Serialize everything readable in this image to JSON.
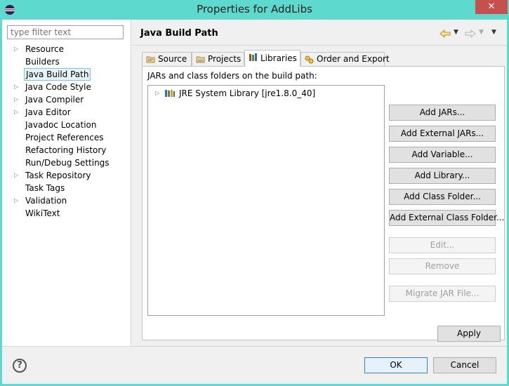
{
  "window": {
    "title": "Properties for AddLibs",
    "close_label": "✕"
  },
  "filter": {
    "placeholder": "type filter text",
    "value": ""
  },
  "nav": {
    "items": [
      {
        "label": "Resource",
        "expandable": true
      },
      {
        "label": "Builders",
        "expandable": false
      },
      {
        "label": "Java Build Path",
        "expandable": false,
        "selected": true
      },
      {
        "label": "Java Code Style",
        "expandable": true
      },
      {
        "label": "Java Compiler",
        "expandable": true
      },
      {
        "label": "Java Editor",
        "expandable": true
      },
      {
        "label": "Javadoc Location",
        "expandable": false
      },
      {
        "label": "Project References",
        "expandable": false
      },
      {
        "label": "Refactoring History",
        "expandable": false
      },
      {
        "label": "Run/Debug Settings",
        "expandable": false
      },
      {
        "label": "Task Repository",
        "expandable": true
      },
      {
        "label": "Task Tags",
        "expandable": false
      },
      {
        "label": "Validation",
        "expandable": true
      },
      {
        "label": "WikiText",
        "expandable": false
      }
    ]
  },
  "page": {
    "title": "Java Build Path"
  },
  "tabs": [
    {
      "label": "Source",
      "icon": "source-folder-icon"
    },
    {
      "label": "Projects",
      "icon": "projects-folder-icon"
    },
    {
      "label": "Libraries",
      "icon": "libraries-icon",
      "active": true
    },
    {
      "label": "Order and Export",
      "icon": "order-export-icon"
    }
  ],
  "libraries": {
    "caption": "JARs and class folders on the build path:",
    "entries": [
      {
        "label": "JRE System Library [jre1.8.0_40]",
        "icon": "jre-library-icon"
      }
    ],
    "buttons": {
      "add_jars": "Add JARs...",
      "add_external_jars": "Add External JARs...",
      "add_variable": "Add Variable...",
      "add_library": "Add Library...",
      "add_class_folder": "Add Class Folder...",
      "add_external_class_folder": "Add External Class Folder...",
      "edit": "Edit...",
      "remove": "Remove",
      "migrate_jar": "Migrate JAR File..."
    }
  },
  "actions": {
    "apply": "Apply",
    "ok": "OK",
    "cancel": "Cancel",
    "help": "?"
  },
  "colors": {
    "titlebar": "#5dd9cd",
    "close": "#c7504f",
    "selection": "#e5f3fb"
  }
}
